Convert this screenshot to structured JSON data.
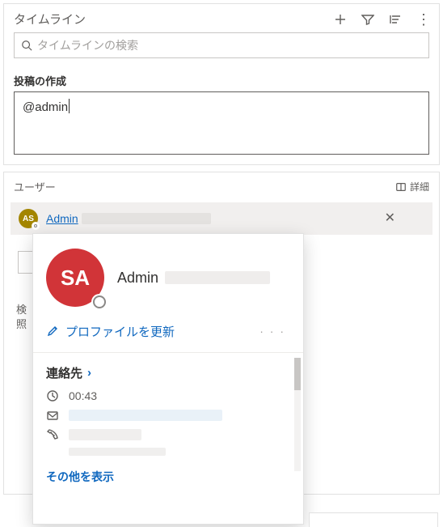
{
  "timeline": {
    "title": "タイムライン",
    "search_placeholder": "タイムラインの検索",
    "compose_label": "投稿の作成",
    "compose_value": "@admin"
  },
  "icons": {
    "add": "add-icon",
    "filter": "filter-icon",
    "sort": "sort-icon",
    "more": "⋮",
    "search": "search-icon",
    "detail": "detail-icon",
    "close": "✕",
    "edit": "edit-icon",
    "clock": "clock-icon",
    "mail": "mail-icon",
    "phone": "phone-icon",
    "chevron": "›"
  },
  "users": {
    "header": "ユーザー",
    "detail_label": "詳細",
    "suggestion": {
      "initials": "AS",
      "name": "Admin"
    }
  },
  "profile_card": {
    "avatar_initials": "SA",
    "display_name": "Admin",
    "edit_label": "プロファイルを更新",
    "ellipsis": "· · ·",
    "contacts_header": "連絡先",
    "rows": {
      "time": "00:43"
    },
    "more_label": "その他を表示"
  },
  "ghost": {
    "line1": "検",
    "line2": "照"
  },
  "colors": {
    "accent_red": "#d13438",
    "accent_olive": "#a38500",
    "link_blue": "#1068bf"
  }
}
